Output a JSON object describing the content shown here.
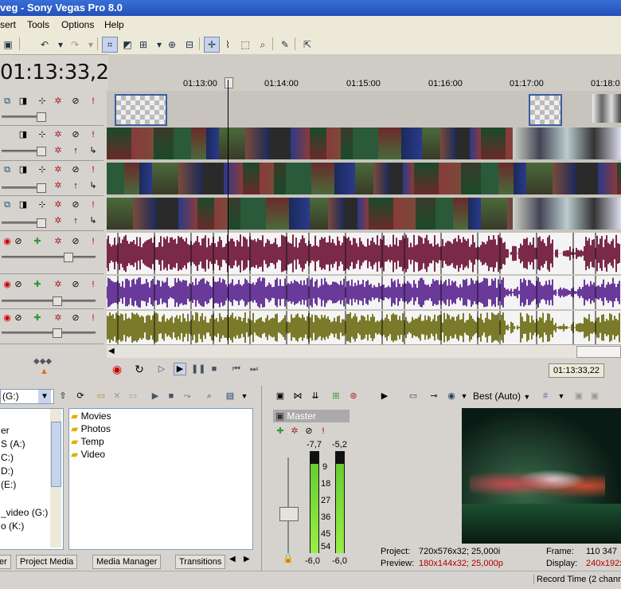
{
  "window": {
    "title": "veg - Sony Vegas Pro 8.0"
  },
  "menu": [
    "sert",
    "Tools",
    "Options",
    "Help"
  ],
  "timeline": {
    "timecode": "01:13:33,22",
    "ruler_labels": [
      "01:13:00",
      "01:14:00",
      "01:15:00",
      "01:16:00",
      "01:17:00",
      "01:18:0"
    ],
    "transport_timecode": "01:13:33,22"
  },
  "explorer": {
    "drive": "(G:)",
    "tree": [
      "er",
      "S (A:)",
      "C:)",
      "D:)",
      "(E:)",
      "_video (G:)",
      "o (K:)"
    ],
    "folders": [
      "Movies",
      "Photos",
      "Temp",
      "Video"
    ],
    "tabs": [
      "er",
      "Project Media",
      "Media Manager",
      "Transitions"
    ]
  },
  "mixer": {
    "bus_name": "Master",
    "peak_left": "-7,7",
    "peak_right": "-5,2",
    "scale": [
      "9",
      "18",
      "27",
      "36",
      "45",
      "54"
    ],
    "level_left": "-6,0",
    "level_right": "-6,0"
  },
  "preview": {
    "quality": "Best (Auto)",
    "project_label": "Project:",
    "project_value": "720x576x32; 25,000i",
    "preview_label": "Preview:",
    "preview_value": "180x144x32; 25,000p",
    "frame_label": "Frame:",
    "frame_value": "110 347",
    "display_label": "Display:",
    "display_value": "240x192x"
  },
  "status": {
    "record_time": "Record Time (2 chann"
  },
  "colors": {
    "audio1": "#7a2a48",
    "audio2": "#6a3a9a",
    "audio3": "#7a7a2a",
    "titlebar": "#2a58c0"
  }
}
